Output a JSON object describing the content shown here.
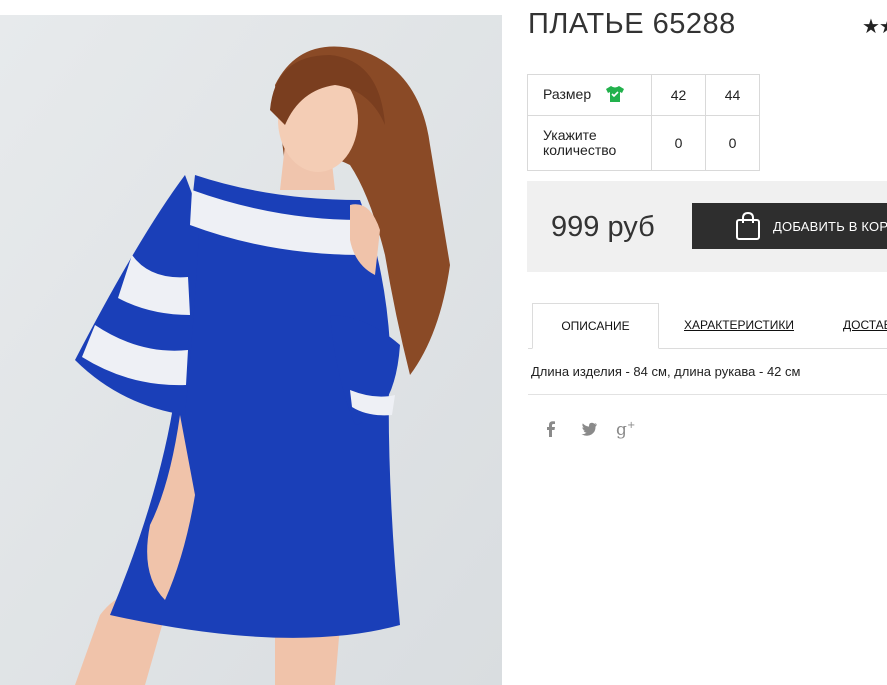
{
  "product": {
    "title": "ПЛАТЬЕ 65288",
    "rating_stars": "★★"
  },
  "size_table": {
    "size_label": "Размер",
    "size_icon": "shirt-icon",
    "size_icon_color": "#22b14c",
    "sizes": [
      "42",
      "44"
    ],
    "quantity_label_line1": "Укажите",
    "quantity_label_line2": "количество",
    "quantities": [
      "0",
      "0"
    ]
  },
  "price": {
    "amount": "999 руб",
    "add_to_cart_label": "ДОБАВИТЬ В КОРЗИНУ",
    "button_color": "#2e2e2e"
  },
  "tabs": [
    {
      "label": "ОПИСАНИЕ",
      "active": true
    },
    {
      "label": "ХАРАКТЕРИСТИКИ",
      "active": false
    },
    {
      "label": "ДОСТАВКА",
      "active": false
    }
  ],
  "description": "Длина изделия - 84 см, длина рукава - 42 см",
  "social": [
    "facebook-icon",
    "twitter-icon",
    "google-plus-icon"
  ],
  "colors": {
    "dress_blue": "#1a3fb8",
    "stripe_white": "#eef0f5"
  }
}
